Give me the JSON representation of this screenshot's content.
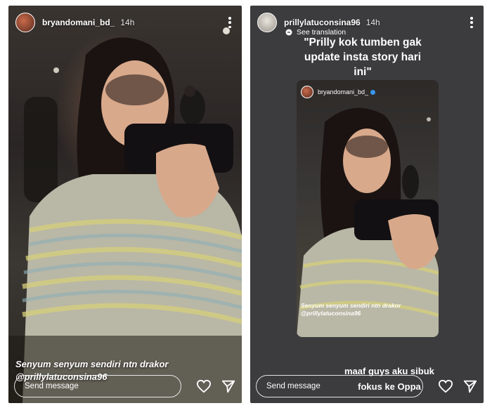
{
  "left_story": {
    "username": "bryandomani_bd_",
    "time": "14h",
    "caption_line1": "Senyum senyum sendiri ntn drakor",
    "caption_line2": "@prillylatuconsina96",
    "send_placeholder": "Send message",
    "avatar_icon": "profile-photo",
    "heart_icon": "heart-outline",
    "send_icon": "paper-plane"
  },
  "right_story": {
    "username": "prillylatuconsina96",
    "time": "14h",
    "see_translation": "See translation",
    "quote_line1": "\"Prilly kok tumben gak",
    "quote_line2": "update insta story hari",
    "quote_line3": "ini\"",
    "reply_line1": "maaf guys aku sibuk",
    "reply_line2": "fokus ke Oppa",
    "send_placeholder": "Send message",
    "avatar_icon": "profile-photo",
    "heart_icon": "heart-outline",
    "send_icon": "paper-plane",
    "reshared_story": {
      "username": "bryandomani_bd_",
      "caption_line1": "Senyum senyum sendiri ntn drakor",
      "caption_line2": "@prillylatuconsina96",
      "verified_icon": "verified-badge"
    }
  },
  "colors": {
    "story_bg_right": "#3c3b3d",
    "text": "#ffffff",
    "verified": "#3897f0"
  }
}
